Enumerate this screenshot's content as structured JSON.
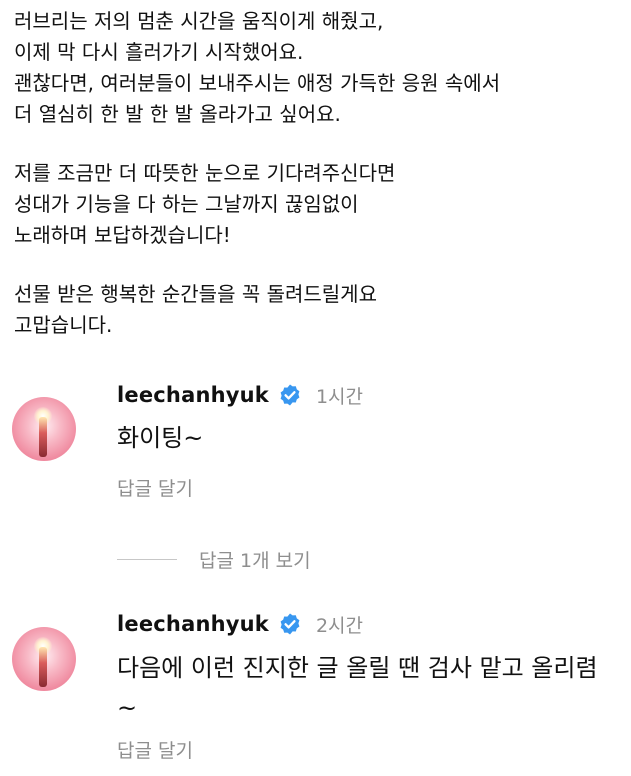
{
  "caption": {
    "lines": [
      "러브리는 저의 멈춘 시간을 움직이게 해줬고,",
      "이제 막 다시 흘러가기 시작했어요.",
      "괜찮다면, 여러분들이 보내주시는 애정 가득한 응원 속에서",
      "더 열심히 한 발 한 발 올라가고 싶어요.",
      "저를 조금만 더 따뜻한 눈으로 기다려주신다면",
      "성대가 기능을 다 하는 그날까지 끊임없이",
      "노래하며 보답하겠습니다!",
      "선물 받은 행복한 순간들을 꼭 돌려드릴게요",
      "고맙습니다."
    ]
  },
  "comments": [
    {
      "username": "leechanhyuk",
      "time": "1시간",
      "text": "화이팅~",
      "reply_label": "답글 달기"
    },
    {
      "username": "leechanhyuk",
      "time": "2시간",
      "text": "다음에 이런 진지한 글 올릴 땐 검사 맡고 올리렴~",
      "reply_label": "답글 달기"
    }
  ],
  "view_replies_label": "답글 1개 보기",
  "colors": {
    "verified_badge": "#3897f0",
    "secondary_text": "#8e8e8e"
  },
  "icons": {
    "verified": "verified-badge-icon"
  }
}
